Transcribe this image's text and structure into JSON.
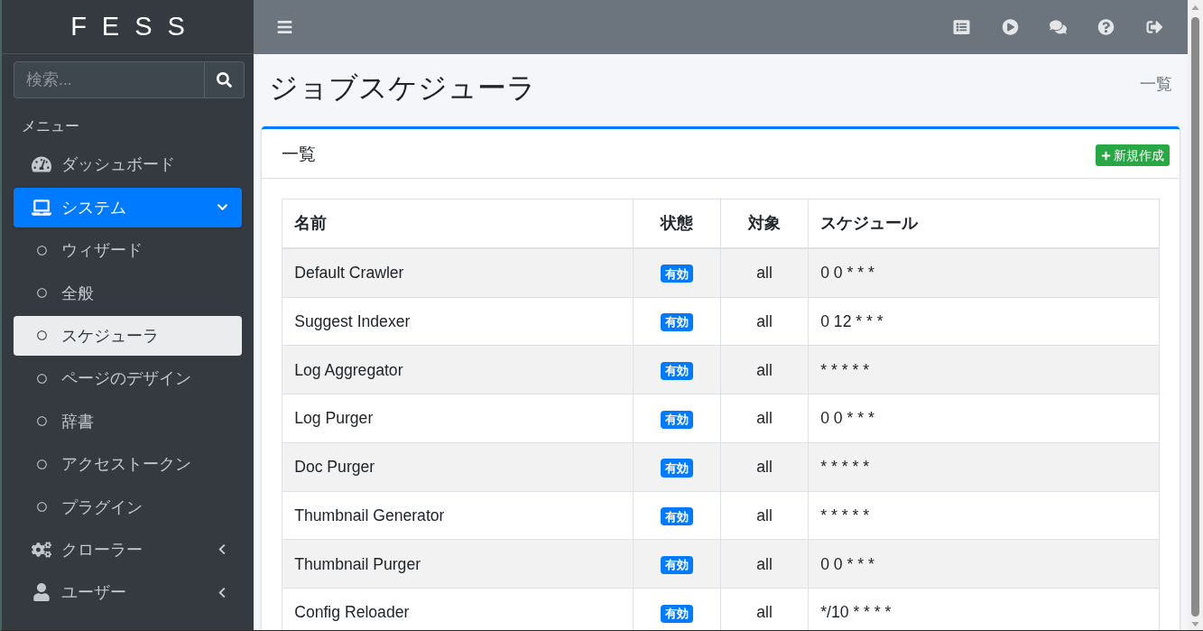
{
  "sidebar": {
    "logo": "FESS",
    "search": {
      "placeholder": "検索..."
    },
    "menu_header": "メニュー",
    "items": [
      {
        "kind": "link",
        "label": "ダッシュボード",
        "selected": false
      },
      {
        "kind": "group",
        "label": "システム",
        "selected": true,
        "expanded": true,
        "children": [
          {
            "label": "ウィザード",
            "selected": false
          },
          {
            "label": "全般",
            "selected": false
          },
          {
            "label": "スケジューラ",
            "selected": true
          },
          {
            "label": "ページのデザイン",
            "selected": false
          },
          {
            "label": "辞書",
            "selected": false
          },
          {
            "label": "アクセストークン",
            "selected": false
          },
          {
            "label": "プラグイン",
            "selected": false
          }
        ]
      },
      {
        "kind": "group",
        "label": "クローラー",
        "selected": false,
        "expanded": false
      },
      {
        "kind": "group",
        "label": "ユーザー",
        "selected": false,
        "expanded": false
      }
    ]
  },
  "page": {
    "title": "ジョブスケジューラ",
    "breadcrumb": "一覧"
  },
  "card": {
    "title": "一覧",
    "create_button": "新規作成",
    "table": {
      "columns": [
        "名前",
        "状態",
        "対象",
        "スケジュール"
      ],
      "rows": [
        {
          "name": "Default Crawler",
          "status": "有効",
          "target": "all",
          "schedule": "0 0 * * *"
        },
        {
          "name": "Suggest Indexer",
          "status": "有効",
          "target": "all",
          "schedule": "0 12 * * *"
        },
        {
          "name": "Log Aggregator",
          "status": "有効",
          "target": "all",
          "schedule": "* * * * *"
        },
        {
          "name": "Log Purger",
          "status": "有効",
          "target": "all",
          "schedule": "0 0 * * *"
        },
        {
          "name": "Doc Purger",
          "status": "有効",
          "target": "all",
          "schedule": "* * * * *"
        },
        {
          "name": "Thumbnail Generator",
          "status": "有効",
          "target": "all",
          "schedule": "* * * * *"
        },
        {
          "name": "Thumbnail Purger",
          "status": "有効",
          "target": "all",
          "schedule": "0 0 * * *"
        },
        {
          "name": "Config Reloader",
          "status": "有効",
          "target": "all",
          "schedule": "*/10 * * * *"
        }
      ]
    }
  }
}
